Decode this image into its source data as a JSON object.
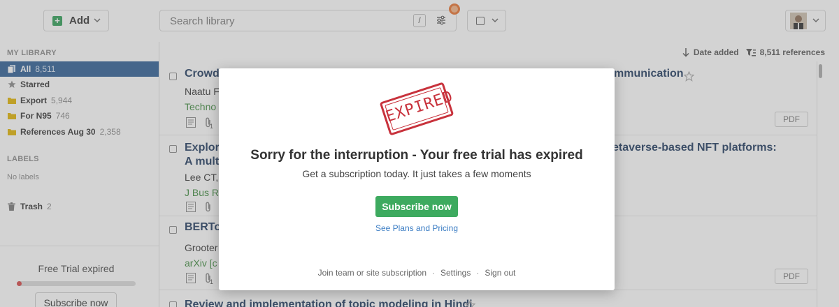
{
  "toolbar": {
    "add_label": "Add",
    "search_placeholder": "Search library",
    "search_shortcut": "/"
  },
  "sidebar": {
    "my_library_title": "MY LIBRARY",
    "items": [
      {
        "label": "All",
        "count": "8,511",
        "icon": "library-icon"
      },
      {
        "label": "Starred",
        "count": "",
        "icon": "star-icon"
      },
      {
        "label": "Export",
        "count": "5,944",
        "icon": "folder-icon"
      },
      {
        "label": "For N95",
        "count": "746",
        "icon": "folder-icon"
      },
      {
        "label": "References Aug 30",
        "count": "2,358",
        "icon": "folder-icon"
      }
    ],
    "labels_title": "LABELS",
    "no_labels": "No labels",
    "trash_label": "Trash",
    "trash_count": "2",
    "trial_title": "Free Trial expired",
    "trial_progress": 0.03,
    "trial_button": "Subscribe now"
  },
  "main": {
    "sort_label": "Date added",
    "ref_count": "8,511 references",
    "rows": [
      {
        "title_start": "Crowd",
        "title_end": "mmunication",
        "authors": "Naatu F",
        "journal": "Techno",
        "attach_count": "1",
        "pdf": "PDF"
      },
      {
        "title_start": "Explor",
        "title_end": "etaverse-based NFT platforms:",
        "title_line2": "A mult",
        "authors": "Lee CT,",
        "journal": "J Bus Re",
        "attach_count": "",
        "pdf": ""
      },
      {
        "title_start": "BERTo",
        "title_end": "",
        "authors": "Grooter",
        "journal": "arXiv [c",
        "attach_count": "1",
        "pdf": "PDF"
      },
      {
        "title_start": "Review and implementation of topic modeling in Hindi",
        "title_end": "",
        "authors": "",
        "journal": "",
        "attach_count": "",
        "pdf": ""
      }
    ]
  },
  "modal": {
    "stamp_text": "EXPIRED",
    "title": "Sorry for the interruption - Your free trial has expired",
    "subtitle": "Get a subscription today. It just takes a few moments",
    "cta": "Subscribe now",
    "link": "See Plans and Pricing",
    "footer": [
      "Join team or site subscription",
      "Settings",
      "Sign out"
    ]
  },
  "colors": {
    "accent_blue": "#2c5d94",
    "cta_green": "#3daa5f",
    "stamp_red": "#c8323c",
    "journal_green": "#3d8a3d"
  }
}
